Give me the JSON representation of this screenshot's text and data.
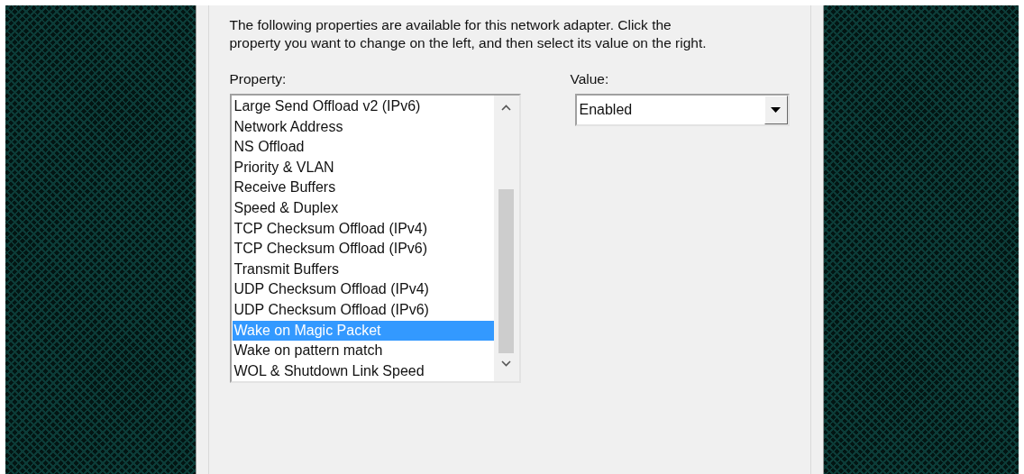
{
  "description": "The following properties are available for this network adapter. Click the property you want to change on the left, and then select its value on the right.",
  "property_label": "Property:",
  "properties": [
    {
      "label": "Large Send Offload v2 (IPv6)",
      "selected": false
    },
    {
      "label": "Network Address",
      "selected": false
    },
    {
      "label": "NS Offload",
      "selected": false
    },
    {
      "label": "Priority & VLAN",
      "selected": false
    },
    {
      "label": "Receive Buffers",
      "selected": false
    },
    {
      "label": "Speed & Duplex",
      "selected": false
    },
    {
      "label": "TCP Checksum Offload (IPv4)",
      "selected": false
    },
    {
      "label": "TCP Checksum Offload (IPv6)",
      "selected": false
    },
    {
      "label": "Transmit Buffers",
      "selected": false
    },
    {
      "label": "UDP Checksum Offload (IPv4)",
      "selected": false
    },
    {
      "label": "UDP Checksum Offload (IPv6)",
      "selected": false
    },
    {
      "label": "Wake on Magic Packet",
      "selected": true
    },
    {
      "label": "Wake on pattern match",
      "selected": false
    },
    {
      "label": "WOL & Shutdown Link Speed",
      "selected": false
    }
  ],
  "value_label": "Value:",
  "value": "Enabled"
}
